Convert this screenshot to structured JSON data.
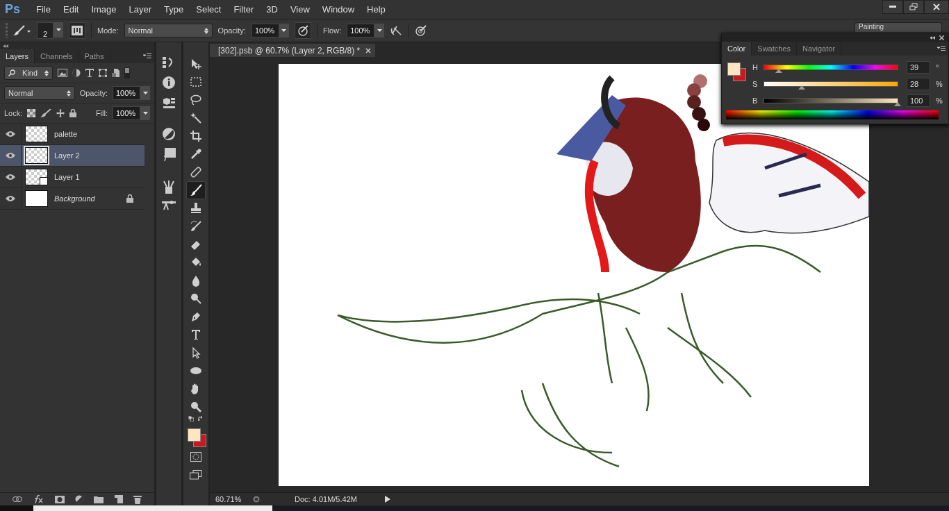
{
  "app": {
    "logo": "Ps"
  },
  "menu": [
    "File",
    "Edit",
    "Image",
    "Layer",
    "Type",
    "Select",
    "Filter",
    "3D",
    "View",
    "Window",
    "Help"
  ],
  "options_bar": {
    "brush_size": "2",
    "mode_label": "Mode:",
    "mode": "Normal",
    "opacity_label": "Opacity:",
    "opacity": "100%",
    "flow_label": "Flow:",
    "flow": "100%",
    "workspace": "Painting"
  },
  "layers_panel": {
    "tabs": [
      {
        "label": "Layers",
        "selected": true
      },
      {
        "label": "Channels",
        "selected": false
      },
      {
        "label": "Paths",
        "selected": false
      }
    ],
    "filter": "Kind",
    "blend_mode": "Normal",
    "opacity_label": "Opacity:",
    "opacity": "100%",
    "lock_label": "Lock:",
    "fill_label": "Fill:",
    "fill": "100%",
    "layers": [
      {
        "name": "palette",
        "kind": "pixel",
        "selected": false,
        "locked": false
      },
      {
        "name": "Layer 2",
        "kind": "pixel",
        "selected": true,
        "locked": false
      },
      {
        "name": "Layer 1",
        "kind": "smart",
        "selected": false,
        "locked": false
      },
      {
        "name": "Background",
        "kind": "background",
        "selected": false,
        "locked": true
      }
    ]
  },
  "tools": [
    {
      "kind": "move",
      "selected": false
    },
    {
      "kind": "marquee",
      "selected": false
    },
    {
      "kind": "lasso",
      "selected": false
    },
    {
      "kind": "wand",
      "selected": false
    },
    {
      "kind": "crop",
      "selected": false
    },
    {
      "kind": "eyedropper",
      "selected": false
    },
    {
      "kind": "healing",
      "selected": false
    },
    {
      "kind": "brush",
      "selected": true
    },
    {
      "kind": "stamp",
      "selected": false
    },
    {
      "kind": "history",
      "selected": false
    },
    {
      "kind": "eraser",
      "selected": false
    },
    {
      "kind": "bucket",
      "selected": false
    },
    {
      "kind": "blur",
      "selected": false
    },
    {
      "kind": "dodge",
      "selected": false
    },
    {
      "kind": "pen",
      "selected": false
    },
    {
      "kind": "type",
      "selected": false
    },
    {
      "kind": "select",
      "selected": false
    },
    {
      "kind": "ellipse",
      "selected": false
    },
    {
      "kind": "hand",
      "selected": false
    },
    {
      "kind": "zoom",
      "selected": false
    }
  ],
  "document": {
    "tab_title": "[302].psb @ 60.7% (Layer 2, RGB/8) *",
    "zoom": "60.71%",
    "doc_info": "Doc: 4.01M/5.42M"
  },
  "color_panel": {
    "tabs": [
      {
        "label": "Color",
        "selected": true
      },
      {
        "label": "Swatches",
        "selected": false
      },
      {
        "label": "Navigator",
        "selected": false
      }
    ],
    "sliders": [
      {
        "label": "H",
        "kind": "hue",
        "level": 0.108,
        "reading": "39",
        "unit": "°"
      },
      {
        "label": "S",
        "kind": "saturation",
        "level": 0.28,
        "reading": "28",
        "unit": "%"
      },
      {
        "label": "B",
        "kind": "brightness",
        "level": 1,
        "reading": "100",
        "unit": "%"
      }
    ]
  }
}
